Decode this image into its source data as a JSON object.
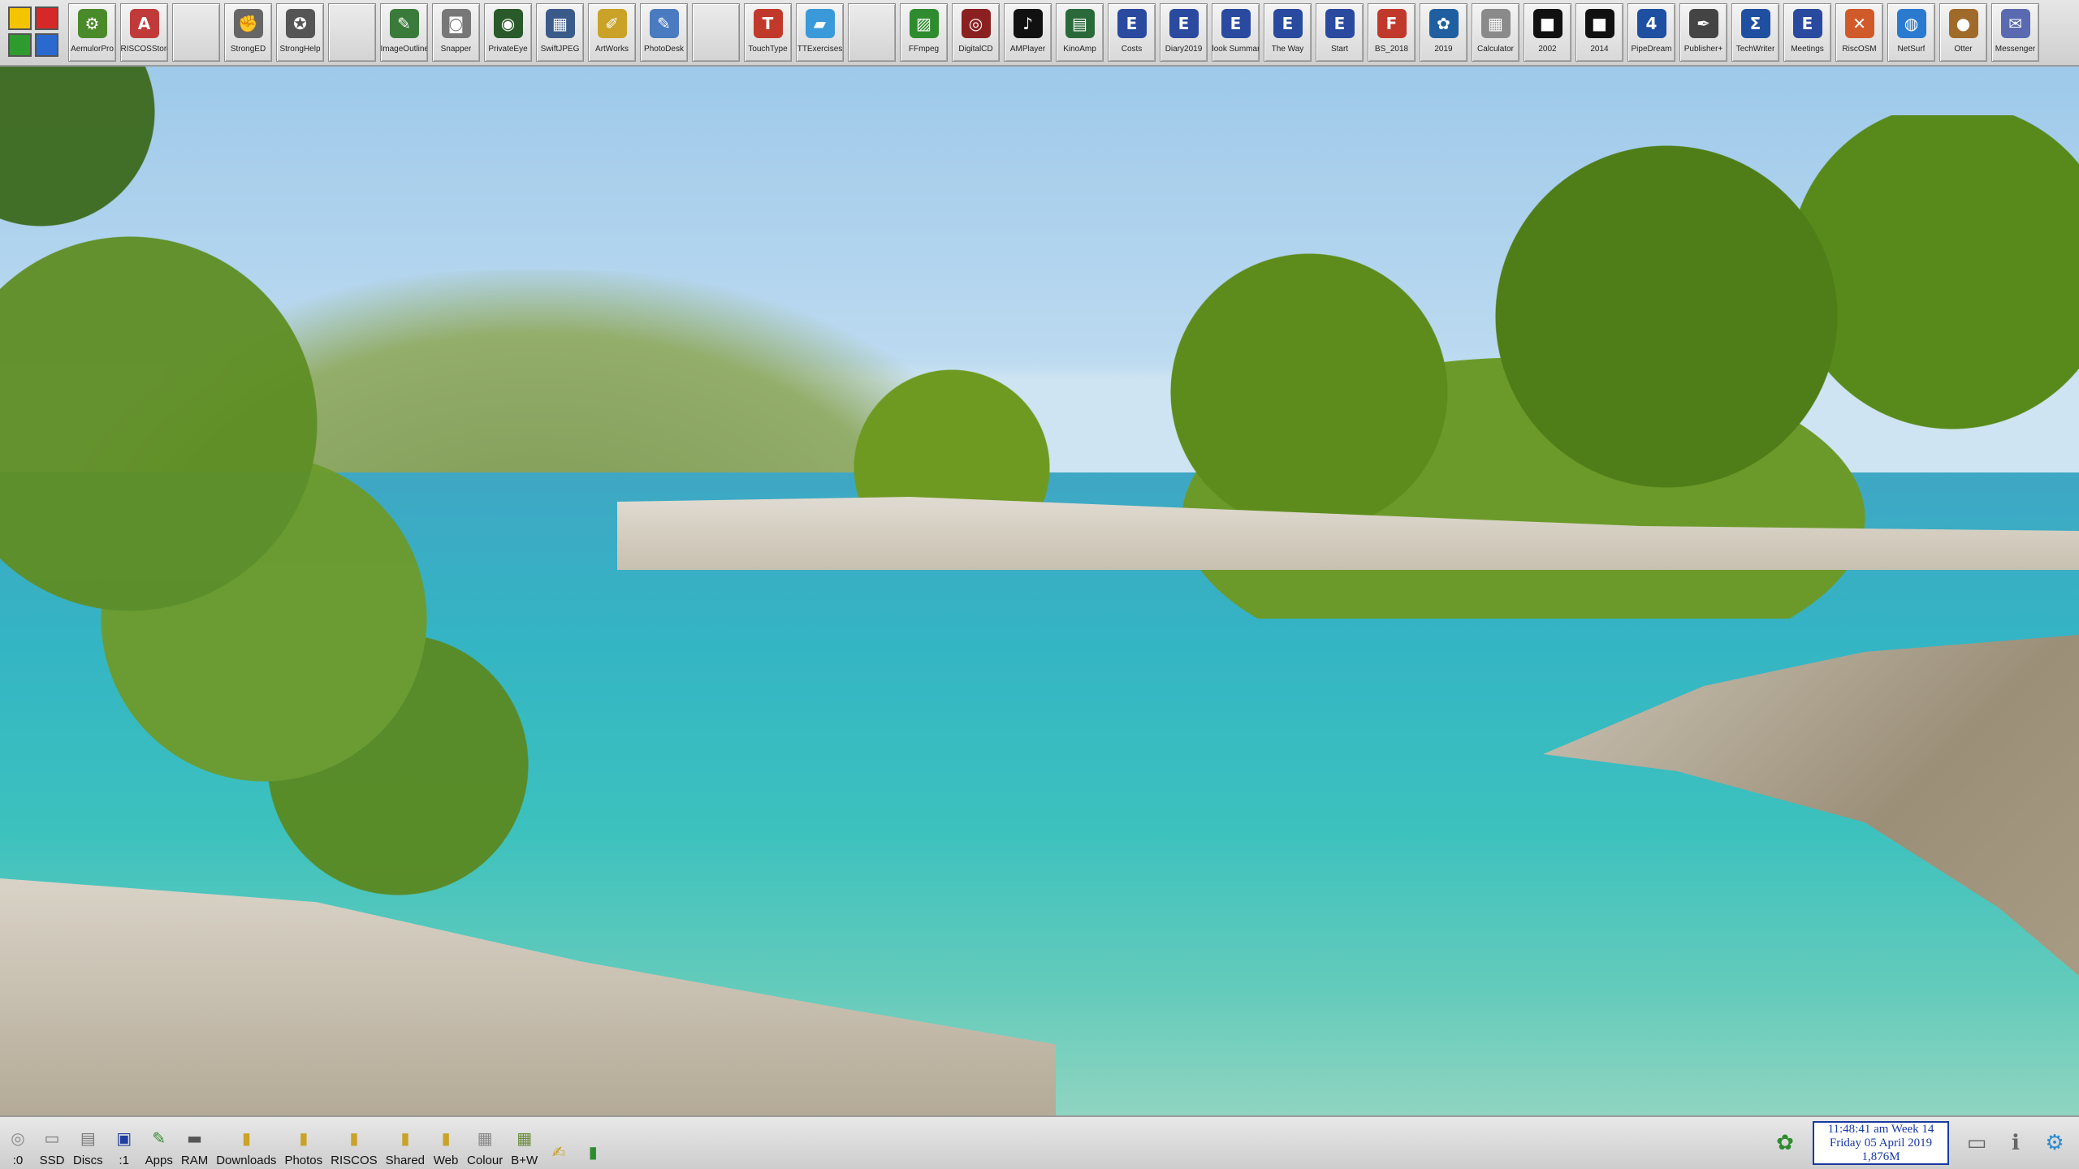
{
  "topbar": {
    "items": [
      {
        "label": "AemulorPro",
        "icon": "aemulor-icon",
        "glyph": "⚙",
        "color": "#4a8a2a"
      },
      {
        "label": "RISCOSStore",
        "icon": "store-icon",
        "glyph": "A",
        "color": "#c03a3a"
      },
      {
        "label": "",
        "icon": "",
        "glyph": "",
        "color": ""
      },
      {
        "label": "StrongED",
        "icon": "fist-icon",
        "glyph": "✊",
        "color": "#666666"
      },
      {
        "label": "StrongHelp",
        "icon": "help-icon",
        "glyph": "✪",
        "color": "#555555"
      },
      {
        "label": "",
        "icon": "",
        "glyph": "",
        "color": ""
      },
      {
        "label": "ImageOutline",
        "icon": "image-outline-icon",
        "glyph": "✎",
        "color": "#3a7a3a"
      },
      {
        "label": "Snapper",
        "icon": "camera-icon",
        "glyph": "◙",
        "color": "#777777"
      },
      {
        "label": "PrivateEye",
        "icon": "eye-icon",
        "glyph": "◉",
        "color": "#2a5a2a"
      },
      {
        "label": "SwiftJPEG",
        "icon": "jpeg-icon",
        "glyph": "▦",
        "color": "#3a5a8a"
      },
      {
        "label": "ArtWorks",
        "icon": "artworks-icon",
        "glyph": "✐",
        "color": "#c9a227"
      },
      {
        "label": "PhotoDesk",
        "icon": "photodesk-icon",
        "glyph": "✎",
        "color": "#4a7ac0"
      },
      {
        "label": "",
        "icon": "",
        "glyph": "",
        "color": ""
      },
      {
        "label": "TouchType",
        "icon": "touchtype-icon",
        "glyph": "T",
        "color": "#c0392b"
      },
      {
        "label": "TTExercises",
        "icon": "folder-icon",
        "glyph": "▰",
        "color": "#3a9ad9"
      },
      {
        "label": "",
        "icon": "",
        "glyph": "",
        "color": ""
      },
      {
        "label": "FFmpeg",
        "icon": "ffmpeg-icon",
        "glyph": "▨",
        "color": "#2e8b2e"
      },
      {
        "label": "DigitalCD",
        "icon": "cd-icon",
        "glyph": "◎",
        "color": "#8b2020"
      },
      {
        "label": "AMPlayer",
        "icon": "music-note-icon",
        "glyph": "♪",
        "color": "#111111"
      },
      {
        "label": "KinoAmp",
        "icon": "film-icon",
        "glyph": "▤",
        "color": "#2a6a3a"
      },
      {
        "label": "Costs",
        "icon": "document-icon",
        "glyph": "E",
        "color": "#2a4aa0"
      },
      {
        "label": "Diary2019",
        "icon": "document-icon",
        "glyph": "E",
        "color": "#2a4aa0"
      },
      {
        "label": "look Summar",
        "icon": "document-icon",
        "glyph": "E",
        "color": "#2a4aa0"
      },
      {
        "label": "The Way",
        "icon": "document-icon",
        "glyph": "E",
        "color": "#2a4aa0"
      },
      {
        "label": "Start",
        "icon": "document-icon",
        "glyph": "E",
        "color": "#2a4aa0"
      },
      {
        "label": "BS_2018",
        "icon": "prophet-file-icon",
        "glyph": "F",
        "color": "#c0392b"
      },
      {
        "label": "2019",
        "icon": "globe-gear-icon",
        "glyph": "✿",
        "color": "#1f5fa0"
      },
      {
        "label": "Calculator",
        "icon": "calculator-icon",
        "glyph": "▦",
        "color": "#8a8a8a"
      },
      {
        "label": "2002",
        "icon": "spreadsheet-icon",
        "glyph": "■",
        "color": "#111111"
      },
      {
        "label": "2014",
        "icon": "spreadsheet-icon",
        "glyph": "■",
        "color": "#111111"
      },
      {
        "label": "PipeDream",
        "icon": "pipedream-icon",
        "glyph": "4",
        "color": "#1f4fa0"
      },
      {
        "label": "Publisher+",
        "icon": "quill-icon",
        "glyph": "✒",
        "color": "#444444"
      },
      {
        "label": "TechWriter",
        "icon": "sigma-icon",
        "glyph": "Σ",
        "color": "#1f4fa0"
      },
      {
        "label": "Meetings",
        "icon": "document-icon",
        "glyph": "E",
        "color": "#2a4aa0"
      },
      {
        "label": "RiscOSM",
        "icon": "map-icon",
        "glyph": "✕",
        "color": "#d05a2a"
      },
      {
        "label": "NetSurf",
        "icon": "globe-icon",
        "glyph": "◍",
        "color": "#2a7ad0"
      },
      {
        "label": "Otter",
        "icon": "otter-icon",
        "glyph": "●",
        "color": "#a06a2a"
      },
      {
        "label": "Messenger",
        "icon": "messenger-icon",
        "glyph": "✉",
        "color": "#5a6ab0"
      }
    ]
  },
  "bottombar": {
    "items": [
      {
        "label": ":0",
        "icon": "floppy-disc-icon",
        "glyph": "◎",
        "color": "#888888"
      },
      {
        "label": "SSD",
        "icon": "drive-icon",
        "glyph": "▭",
        "color": "#777777"
      },
      {
        "label": "Discs",
        "icon": "drives-icon",
        "glyph": "▤",
        "color": "#777777"
      },
      {
        "label": ":1",
        "icon": "sd-card-icon",
        "glyph": "▣",
        "color": "#1f3fa0"
      },
      {
        "label": "Apps",
        "icon": "apps-icon",
        "glyph": "✎",
        "color": "#2e8b2e"
      },
      {
        "label": "RAM",
        "icon": "ram-icon",
        "glyph": "▬",
        "color": "#555555"
      },
      {
        "label": "Downloads",
        "icon": "directory-icon",
        "glyph": "▮",
        "color": "#c9a227"
      },
      {
        "label": "Photos",
        "icon": "directory-icon",
        "glyph": "▮",
        "color": "#c9a227"
      },
      {
        "label": "RISCOS",
        "icon": "directory-icon",
        "glyph": "▮",
        "color": "#c9a227"
      },
      {
        "label": "Shared",
        "icon": "directory-icon",
        "glyph": "▮",
        "color": "#c9a227"
      },
      {
        "label": "Web",
        "icon": "directory-icon",
        "glyph": "▮",
        "color": "#c9a227"
      },
      {
        "label": "Colour",
        "icon": "printer-colour-icon",
        "glyph": "▦",
        "color": "#888888"
      },
      {
        "label": "B+W",
        "icon": "printer-bw-icon",
        "glyph": "▦",
        "color": "#6a8a3a"
      },
      {
        "label": "",
        "icon": "paper-icon",
        "glyph": "✍",
        "color": "#c9a227"
      },
      {
        "label": "",
        "icon": "bin-icon",
        "glyph": "▮",
        "color": "#2e8b2e"
      }
    ],
    "clock": {
      "line1": "11:48:41 am  Week 14",
      "line2": "Friday 05 April 2019",
      "line3": "1,876M"
    },
    "tray_left_icon": "acorn-icon",
    "tray_right": [
      {
        "icon": "display-icon",
        "glyph": "▭"
      },
      {
        "icon": "info-icon",
        "glyph": "ℹ"
      },
      {
        "icon": "settings-gear-icon",
        "glyph": "⚙"
      }
    ]
  }
}
